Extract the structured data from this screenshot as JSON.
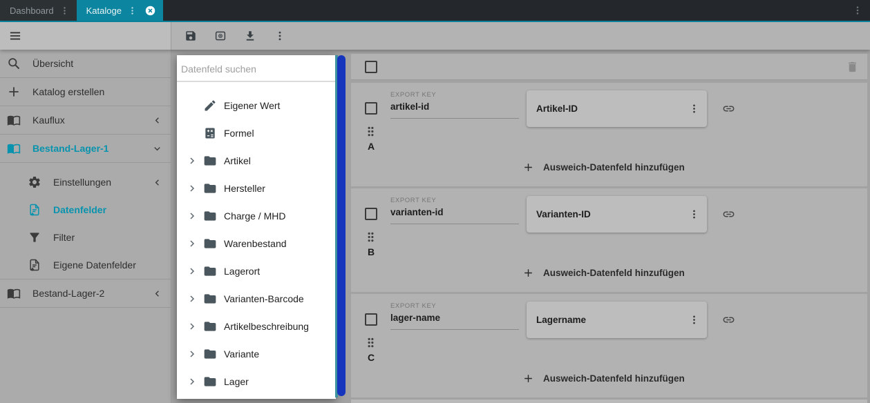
{
  "tab_bar": {
    "tabs": [
      {
        "label": "Dashboard"
      },
      {
        "label": "Kataloge"
      }
    ]
  },
  "toolbar": {
    "icons": [
      "save",
      "preview",
      "download",
      "more-options"
    ]
  },
  "sidebar": {
    "items": [
      {
        "label": "Übersicht",
        "icon": "search"
      },
      {
        "label": "Katalog erstellen",
        "icon": "plus"
      },
      {
        "label": "Kauflux",
        "icon": "catalog-book",
        "chevron": "left"
      },
      {
        "label": "Bestand-Lager-1",
        "icon": "catalog-book",
        "chevron": "down",
        "active": true
      },
      {
        "label": "Einstellungen",
        "icon": "gear",
        "chevron": "left",
        "sub": true
      },
      {
        "label": "Datenfelder",
        "icon": "document-add",
        "active": true,
        "sub": true
      },
      {
        "label": "Filter",
        "icon": "filter-funnel",
        "sub": true
      },
      {
        "label": "Eigene Datenfelder",
        "icon": "document-add",
        "sub": true
      },
      {
        "label": "Bestand-Lager-2",
        "icon": "catalog-book",
        "chevron": "left"
      }
    ]
  },
  "drawer": {
    "search_placeholder": "Datenfeld suchen",
    "items": [
      {
        "label": "Eigener Wert",
        "icon": "pencil"
      },
      {
        "label": "Formel",
        "icon": "calculator"
      },
      {
        "label": "Artikel",
        "icon": "folder",
        "expandable": true
      },
      {
        "label": "Hersteller",
        "icon": "folder",
        "expandable": true
      },
      {
        "label": "Charge / MHD",
        "icon": "folder",
        "expandable": true
      },
      {
        "label": "Warenbestand",
        "icon": "folder",
        "expandable": true
      },
      {
        "label": "Lagerort",
        "icon": "folder",
        "expandable": true
      },
      {
        "label": "Varianten-Barcode",
        "icon": "folder",
        "expandable": true
      },
      {
        "label": "Artikelbeschreibung",
        "icon": "folder",
        "expandable": true
      },
      {
        "label": "Variante",
        "icon": "folder",
        "expandable": true
      },
      {
        "label": "Lager",
        "icon": "folder",
        "expandable": true
      }
    ]
  },
  "main": {
    "export_key_label": "EXPORT KEY",
    "add_fallback_label": "Ausweich-Datenfeld hinzufügen",
    "rows": [
      {
        "letter": "A",
        "export_key": "artikel-id",
        "field_label": "Artikel-ID"
      },
      {
        "letter": "B",
        "export_key": "varianten-id",
        "field_label": "Varianten-ID"
      },
      {
        "letter": "C",
        "export_key": "lager-name",
        "field_label": "Lagername"
      }
    ]
  },
  "colors": {
    "accent_teal": "#0c86a0",
    "active_item_teal": "#0793ae",
    "scrollbar_blue": "#1535bd"
  }
}
